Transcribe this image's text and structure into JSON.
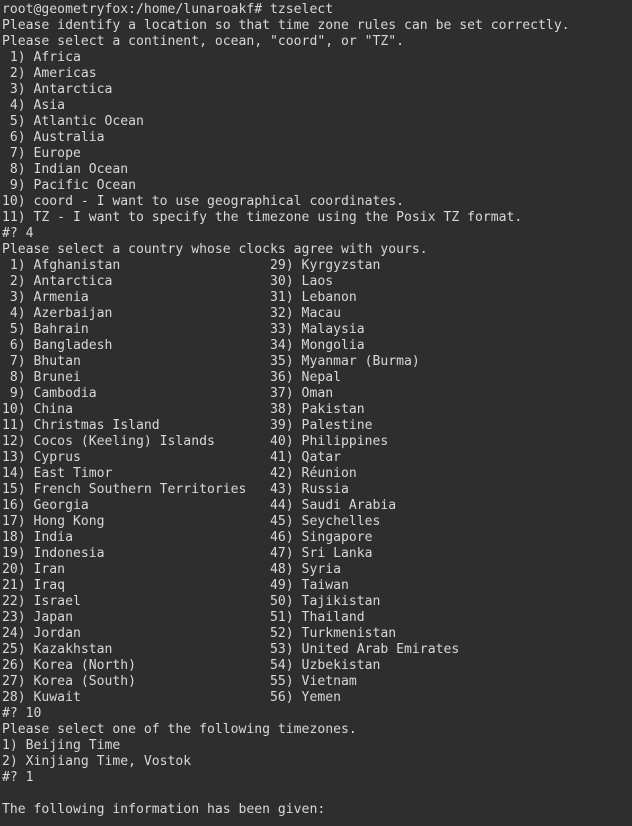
{
  "terminal": {
    "background_color": "#2e2e2e",
    "foreground_color": "#d8d8d8",
    "prompt_line": "root@geometryfox:/home/lunaroakf# tzselect",
    "user_host_path": "root@geometryfox:/home/lunaroakf#",
    "command": "tzselect",
    "intro_line_1": "Please identify a location so that time zone rules can be set correctly.",
    "intro_line_2": "Please select a continent, ocean, \"coord\", or \"TZ\".",
    "continent_menu": [
      " 1) Africa",
      " 2) Americas",
      " 3) Antarctica",
      " 4) Asia",
      " 5) Atlantic Ocean",
      " 6) Australia",
      " 7) Europe",
      " 8) Indian Ocean",
      " 9) Pacific Ocean",
      "10) coord - I want to use geographical coordinates.",
      "11) TZ - I want to specify the timezone using the Posix TZ format."
    ],
    "continent_answer_line": "#? 4",
    "country_prompt": "Please select a country whose clocks agree with yours.",
    "country_menu_lines": [
      " 1) Afghanistan                   29) Kyrgyzstan",
      " 2) Antarctica                    30) Laos",
      " 3) Armenia                       31) Lebanon",
      " 4) Azerbaijan                    32) Macau",
      " 5) Bahrain                       33) Malaysia",
      " 6) Bangladesh                    34) Mongolia",
      " 7) Bhutan                        35) Myanmar (Burma)",
      " 8) Brunei                        36) Nepal",
      " 9) Cambodia                      37) Oman",
      "10) China                         38) Pakistan",
      "11) Christmas Island              39) Palestine",
      "12) Cocos (Keeling) Islands       40) Philippines",
      "13) Cyprus                        41) Qatar",
      "14) East Timor                    42) Réunion",
      "15) French Southern Territories   43) Russia",
      "16) Georgia                       44) Saudi Arabia",
      "17) Hong Kong                     45) Seychelles",
      "18) India                         46) Singapore",
      "19) Indonesia                     47) Sri Lanka",
      "20) Iran                          48) Syria",
      "21) Iraq                          49) Taiwan",
      "22) Israel                        50) Tajikistan",
      "23) Japan                         51) Thailand",
      "24) Jordan                        52) Turkmenistan",
      "25) Kazakhstan                    53) United Arab Emirates",
      "26) Korea (North)                 54) Uzbekistan",
      "27) Korea (South)                 55) Vietnam",
      "28) Kuwait                        56) Yemen"
    ],
    "country_answer_line": "#? 10",
    "timezone_prompt": "Please select one of the following timezones.",
    "timezone_menu": [
      "1) Beijing Time",
      "2) Xinjiang Time, Vostok"
    ],
    "timezone_answer_line": "#? 1",
    "summary_header": "The following information has been given:"
  }
}
